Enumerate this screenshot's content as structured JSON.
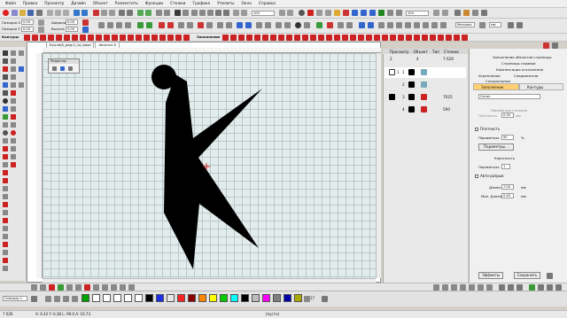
{
  "menubar": {
    "items": [
      "Файл",
      "Правка",
      "Просмотр",
      "Дизайн",
      "Объект",
      "Разместить",
      "Функции",
      "Стежки",
      "Графика",
      "Утилиты",
      "Окно",
      "Справка"
    ]
  },
  "toolbar": {
    "zoom_value": "100",
    "zoom_value_2": "100",
    "pos_x_label": "Позиция X",
    "pos_y_label": "Позиция Y",
    "pos_x": "0.00",
    "pos_y": "0.00",
    "width_label": "Ширина",
    "height_label": "Высота",
    "width": "0.00",
    "height": "0.00",
    "contour_label": "Контуры",
    "fill_label": "Заполнение",
    "units": "Метрика",
    "units_2": "мм"
  },
  "doc_tabs": [
    {
      "label": "Кукла(K_ред.0_1a_base"
    },
    {
      "label": "Abstract K"
    }
  ],
  "popup": {
    "title": "Редактор"
  },
  "objects": {
    "headers": [
      "Просмотр",
      "Объект",
      "Тип",
      "Стежки"
    ],
    "rows": [
      {
        "num": "2",
        "idx": "4",
        "count": "7 626"
      },
      {
        "num": "1",
        "idx": "1"
      },
      {
        "num": "",
        "idx": "2"
      },
      {
        "num": "",
        "idx": "3",
        "count": "7025"
      },
      {
        "num": "",
        "idx": "4",
        "count": "590"
      }
    ]
  },
  "right_panel": {
    "links": [
      "Заполнение объектов страницы",
      "Страницы справки",
      "Компенсация отклонения",
      "Укрепление",
      "Соединители",
      "Специальные"
    ],
    "tabs": [
      "Заполнение",
      "Контуры"
    ],
    "fill_type": "Сатин",
    "group_label": "Параметры стежков",
    "density_label": "Плотность",
    "density_value": "0.30",
    "density_units": "мм",
    "pattern_label": "Плотность",
    "param_label": "Параметры:",
    "param_value": "90",
    "param_unit": "%",
    "param_btn": "Параметры...",
    "short_label": "Короткость",
    "param_label_2": "Параметры:",
    "param_value_2": "1",
    "auto_label": "Авто-разрыв",
    "len_label": "Длина:",
    "len_value": "7.00",
    "len_unit": "мм",
    "min_label": "Мин. Длина:",
    "min_value": "0.40",
    "min_unit": "мм",
    "effects_btn": "Эффекты",
    "save_btn": "Сохранить"
  },
  "palette": {
    "label": "Colorway 1",
    "colors": [
      "#00a000",
      "#ffffff",
      "#1d2ee6",
      "#e6e6e6",
      "#ff2222",
      "#8b0000",
      "#ff8800",
      "#ffff00",
      "#00cc00",
      "#00ffff",
      "#000000",
      "#bbbbbb",
      "#ff00ff",
      "#7f7f7f",
      "#0000aa",
      "#aaaa00"
    ],
    "index": "17"
  },
  "status": {
    "left": "7 626",
    "coords": "X: 6.42 Y: 6.38 L: 99.0 A: 16.73",
    "center": "(пусто)"
  }
}
